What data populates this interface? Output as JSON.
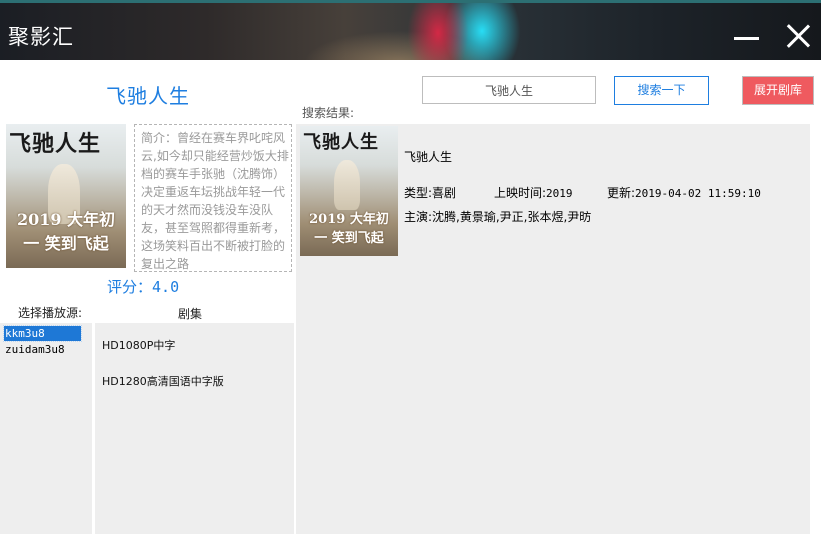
{
  "window": {
    "title": "聚影汇",
    "minimize_icon": "minimize-icon",
    "close_icon": "close-icon"
  },
  "detail": {
    "title": "飞驰人生",
    "poster": {
      "title_text": "飞驰人生",
      "tagline": "2019 大年初一 笑到飞起"
    },
    "synopsis": "简介：曾经在赛车界叱咤风云,如今却只能经营炒饭大排档的赛车手张驰（沈腾饰）决定重返车坛挑战年轻一代的天才然而没钱没车没队友，甚至驾照都得重新考，这场笑料百出不断被打脸的复出之路",
    "rating_label": "评分：",
    "rating_value": "4.0"
  },
  "source": {
    "label": "选择播放源:",
    "items": [
      {
        "label": "kkm3u8",
        "selected": true
      },
      {
        "label": "zuidam3u8",
        "selected": false
      }
    ]
  },
  "episodes": {
    "label": "剧集",
    "items": [
      {
        "label": "HD1080P中字"
      },
      {
        "label": "HD1280高清国语中字版"
      }
    ]
  },
  "search": {
    "value": "飞驰人生",
    "button_label": "搜索一下",
    "library_button_label": "展开剧库",
    "results_label": "搜索结果:"
  },
  "result": {
    "title": "飞驰人生",
    "type_label": "类型:",
    "type_value": "喜剧",
    "release_label": "上映时间:",
    "release_value": "2019",
    "updated_label": "更新:",
    "updated_value": "2019-04-02 11:59:10",
    "actors_label": "主演:",
    "actors_value": "沈腾,黄景瑜,尹正,张本煜,尹昉"
  },
  "colors": {
    "accent": "#1e7ee0",
    "library_button": "#ef5a5f",
    "selection": "#1e78d6",
    "panel": "#eeeeee"
  }
}
